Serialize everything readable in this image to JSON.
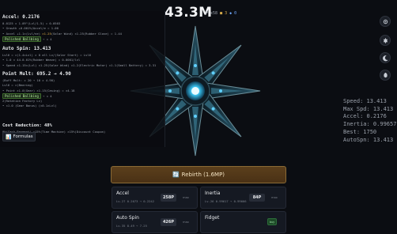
{
  "header": {
    "currency": "43.3M",
    "rate_parts": [
      {
        "text": "P",
        "cls": "c1"
      },
      {
        "text": "x58",
        "cls": "c1"
      },
      {
        "text": "■ 3",
        "cls": "c2"
      },
      {
        "text": "◆ 0",
        "cls": "c3"
      }
    ]
  },
  "icons": [
    "settings-icon",
    "gear-icon",
    "moon-icon",
    "rocket-icon"
  ],
  "stats": {
    "accel": {
      "title": "Accel: 0.2176",
      "lines": [
        {
          "html": "0.0125 × 1.09^(Lvl/1.5) = 0.0503"
        },
        {
          "html": "• Growth +0.001%/Accel/e = 1.00"
        },
        {
          "html": "• Accel +1.1×(Lvl/ne) <span class=\"mul\">×1.25</span>(Solar Wind) ×1.25(Rubber Glove) = 1.44"
        },
        {
          "html": "<span class=\"tag\">Polished Ballbing</span> → × 4"
        }
      ]
    },
    "autospin": {
      "title": "Auto Spin: 13.413",
      "lines": [
        {
          "html": "Lvl6 = ×(1.4×Lvl) × 0 all Lv/(Solar Start) = Lvl6"
        },
        {
          "html": "• 1.0 × 44.0.01%(Rubber Weave) = 0.0001/lvl"
        },
        {
          "html": "• Speed ×1.15×(Lvl) ×1.25(Solar Wind) ×1.2(Electric Motor) ×1.1(Small Battery) = 3.31"
        }
      ]
    },
    "pointmult": {
      "title": "Point Mult: 695.2 → 4.90",
      "lines": [
        {
          "html": "(Buff Mult: × 20 → 10 × 4.90)"
        },
        {
          "html": "Lvl6 = ×(Bearing)"
        },
        {
          "html": "• Point ×1.0(Gear) ×1.15(Casing) = ×4.18"
        },
        {
          "html": "<span class=\"tag\">Polished Ballbing</span> → × 4"
        },
        {
          "html": "2(Rotation Factory Lv)"
        },
        {
          "html": "• ×1.0 (Gear Bonus) (×0.1×Lvl)"
        }
      ]
    },
    "cost": {
      "title": "Cost Reduction: 48%",
      "line": "0%(Cash Payment) ×15%(Time Machine) ×15%(Discount Coupon)",
      "total": "= 48%"
    }
  },
  "formulas_button": {
    "label": "Formulas",
    "icon": "📊"
  },
  "side_stats": [
    "Speed: 13.413",
    "Max Spd: 13.413",
    "Accel: 0.2176",
    "Inertia: 0.99657",
    "Best: 1750",
    "AutoSpn: 13.413"
  ],
  "rebirth": {
    "label": "Rebirth (1.6MP)",
    "icon": "🔄"
  },
  "upgrades": [
    {
      "name": "Accel",
      "detail": "Lv.27  0.2073 → 0.2242",
      "price": "258P",
      "action": "max",
      "buy_style": "gray"
    },
    {
      "name": "Inertia",
      "detail": "Lv.26  0.99617 → 0.99666",
      "price": "84P",
      "action": "max",
      "buy_style": "gray"
    },
    {
      "name": "Auto Spin",
      "detail": "Lv.35  8.49 → 7.25",
      "price": "426P",
      "action": "max",
      "buy_style": "gray"
    },
    {
      "name": "Fidget",
      "detail": "",
      "price": "",
      "action": "buy",
      "buy_style": "green"
    }
  ]
}
